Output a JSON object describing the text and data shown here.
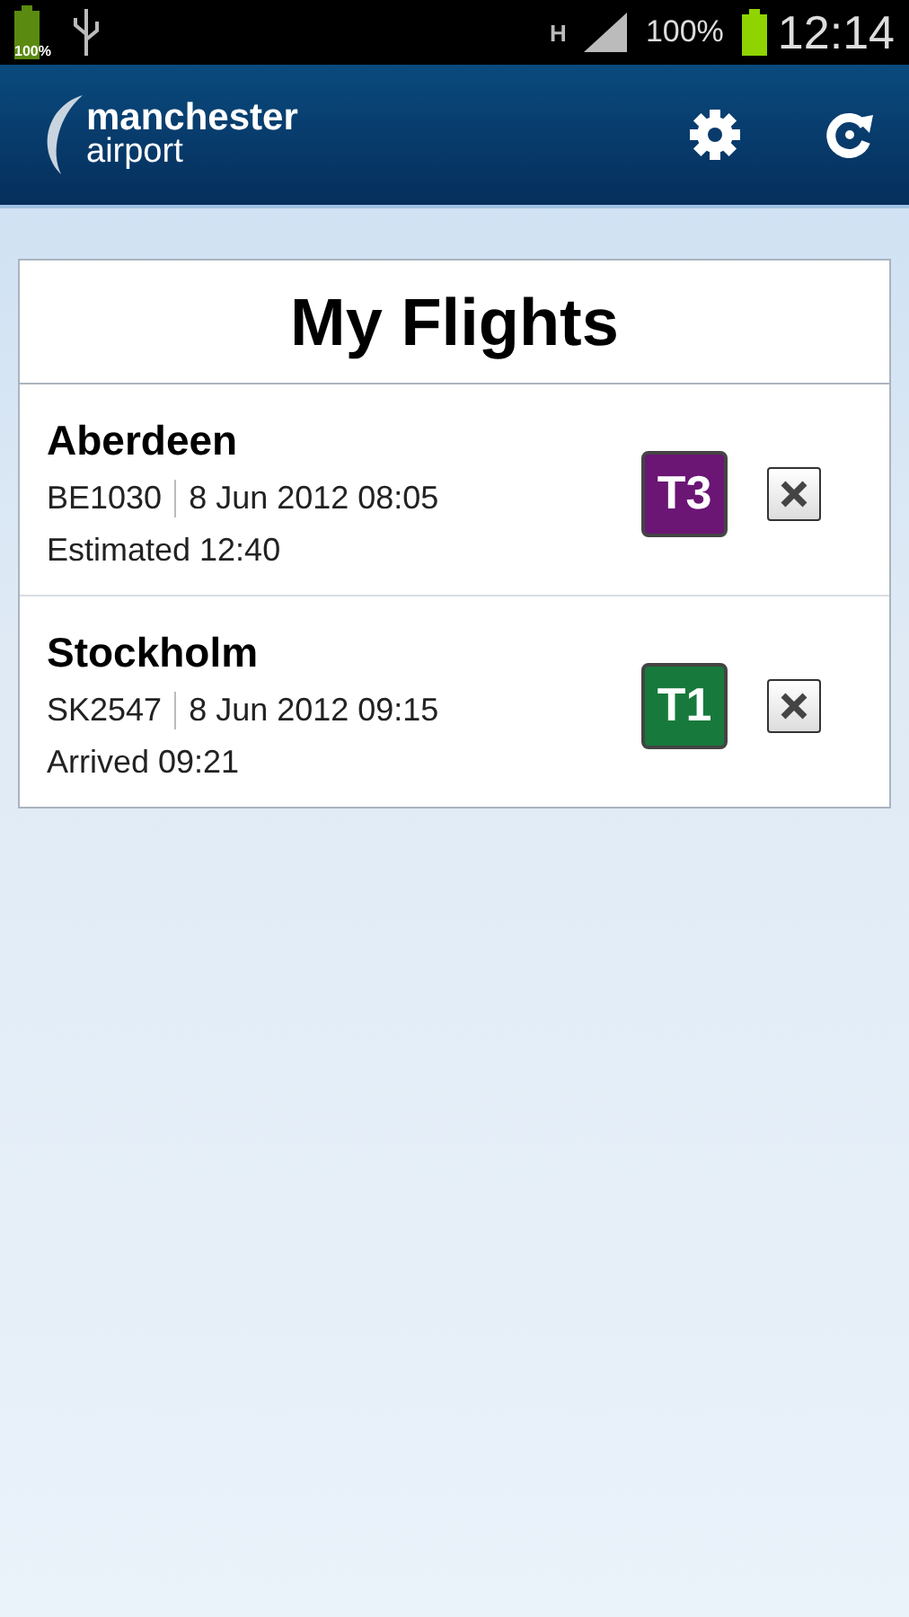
{
  "status_bar": {
    "battery_badge": "100%",
    "network": "H",
    "battery": "100%",
    "time": "12:14"
  },
  "app_bar": {
    "logo_line_1": "manchester",
    "logo_line_2": "airport"
  },
  "title": "My Flights",
  "flights": [
    {
      "city": "Aberdeen",
      "flight": "BE1030",
      "date": "8 Jun 2012 08:05",
      "status": "Estimated 12:40",
      "terminal": "T3",
      "color": "#6b1575"
    },
    {
      "city": "Stockholm",
      "flight": "SK2547",
      "date": "8 Jun 2012 09:15",
      "status": "Arrived 09:21",
      "terminal": "T1",
      "color": "#177a3c"
    }
  ]
}
